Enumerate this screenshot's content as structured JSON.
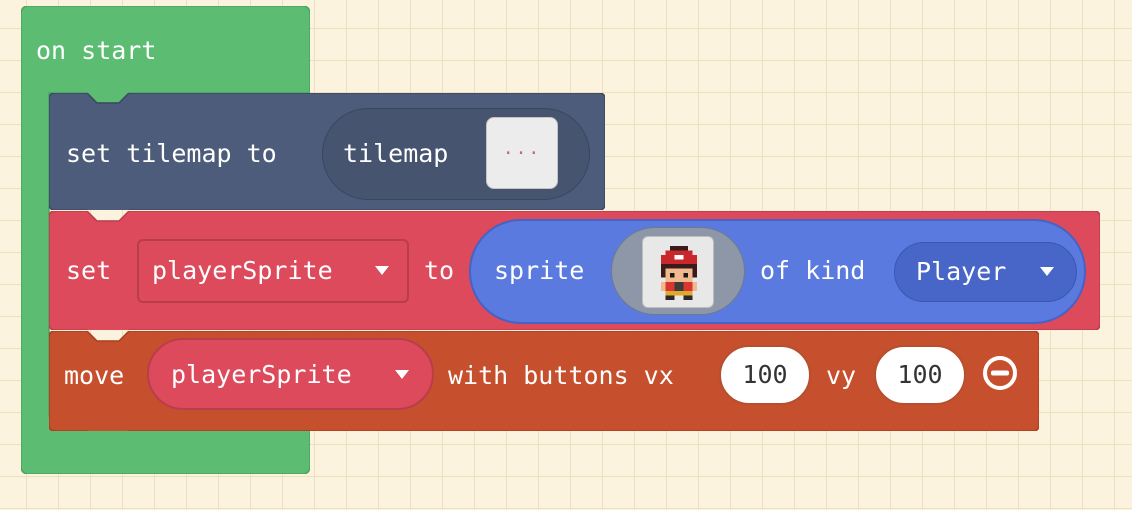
{
  "on_start": {
    "label": "on start",
    "color": "#5cbd72"
  },
  "set_tilemap": {
    "label": "set tilemap to",
    "tilemap_label": "tilemap",
    "tilemap_thumb": "...",
    "color": "#4c5c7a"
  },
  "set_sprite": {
    "set_label": "set",
    "variable": "playerSprite",
    "to_label": "to",
    "sprite_label": "sprite",
    "of_kind_label": "of kind",
    "kind": "Player",
    "color": "#dc4a5c",
    "sprite_block_color": "#5a7ae0"
  },
  "move": {
    "move_label": "move",
    "variable": "playerSprite",
    "with_buttons_label": "with buttons vx",
    "vx": "100",
    "vy_label": "vy",
    "vy": "100",
    "color": "#c64f2e"
  },
  "icons": {
    "dropdown": "caret-down-icon",
    "remove": "minus-circle-icon",
    "sprite": "player-sprite-image"
  }
}
